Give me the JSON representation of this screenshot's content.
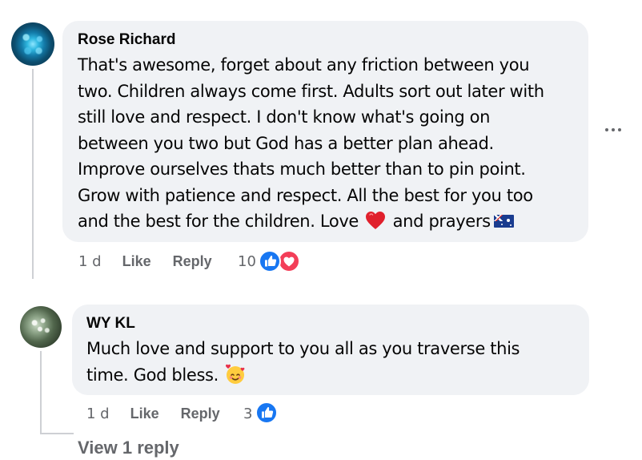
{
  "comments": [
    {
      "author": "Rose Richard",
      "text_main": "That's awesome, forget about any friction between you\ntwo. Children always come first. Adults sort out later with\nstill love and respect. I don't know what's going on\nbetween you two but God has a better plan ahead.\nImprove ourselves thats much better than to pin point.\nGrow with patience and respect. All the best for you too\nand the best for the children. Love",
      "text_tail": "and prayers",
      "emoji": "red-heart",
      "flag": "australia-flag",
      "time": "1 d",
      "like_label": "Like",
      "reply_label": "Reply",
      "reaction_count": "10",
      "reactions": [
        "like",
        "love"
      ]
    },
    {
      "author": "WY KL",
      "text_main": "Much love and support to you all as you traverse this\ntime. God bless.",
      "emoji": "smiling-face-with-hearts",
      "time": "1 d",
      "like_label": "Like",
      "reply_label": "Reply",
      "reaction_count": "3",
      "reactions": [
        "like"
      ]
    }
  ],
  "view_replies_label": "View 1 reply",
  "colors": {
    "bubble": "#f0f2f5",
    "meta_text": "#65676b",
    "like_blue": "#1877f2",
    "love_red": "#f33e58"
  }
}
